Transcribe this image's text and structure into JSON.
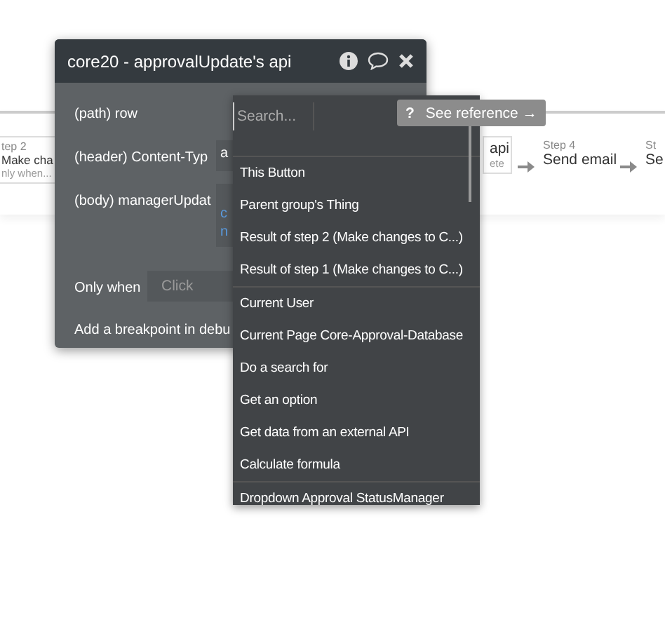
{
  "canvas": {
    "steps": [
      {
        "label": "tep 2",
        "title": "Make cha",
        "note": "nly when..."
      },
      {
        "title": "api",
        "note": "ete"
      },
      {
        "label": "Step 4",
        "title": "Send email"
      },
      {
        "label": "St",
        "title": "Se"
      }
    ]
  },
  "panel": {
    "title": "core20 - approvalUpdate's api",
    "fields": [
      {
        "label": "(path) row"
      },
      {
        "label": "(header) Content-Typ",
        "value": "a"
      },
      {
        "label": "(body) managerUpdat",
        "value": "c\nn"
      }
    ],
    "only_when": {
      "label": "Only when",
      "placeholder": "Click"
    },
    "breakpoint": "Add a breakpoint in debu"
  },
  "dropdown": {
    "search": {
      "placeholder": "Search..."
    },
    "sections": [
      [
        "This Button",
        "Parent group's Thing",
        "Result of step 2 (Make changes to C...)",
        "Result of step 1 (Make changes to C...)"
      ],
      [
        "Current User",
        "Current Page Core-Approval-Database",
        "Do a search for",
        "Get an option",
        "Get data from an external API",
        "Calculate formula"
      ],
      [
        "Dropdown Approval StatusManager"
      ]
    ]
  },
  "tooltip": {
    "icon": "?",
    "text": "See reference →"
  }
}
